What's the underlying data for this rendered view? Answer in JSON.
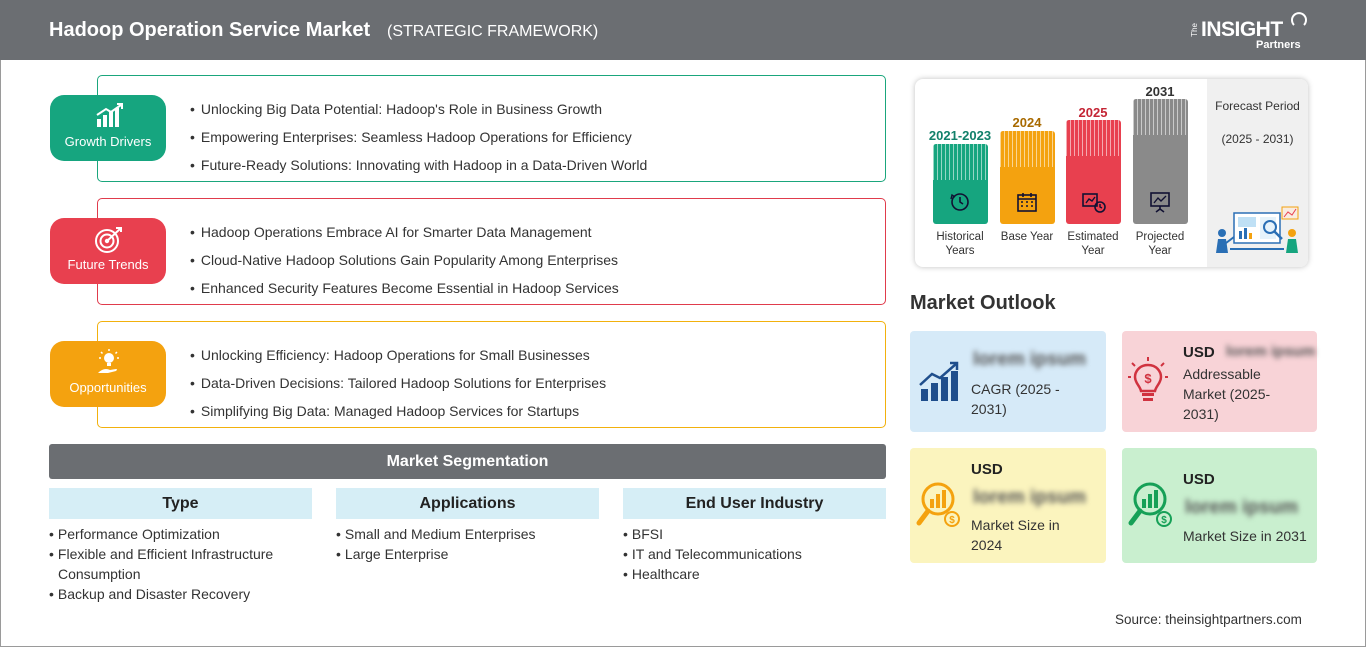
{
  "header": {
    "title": "Hadoop Operation Service Market",
    "subtitle": "(STRATEGIC FRAMEWORK)",
    "logo": {
      "the": "The",
      "insight": "INSIGHT",
      "partners": "Partners"
    }
  },
  "framework": {
    "growth_drivers": {
      "label": "Growth Drivers",
      "color": "#16a57f",
      "items": [
        "Unlocking Big Data Potential: Hadoop's Role in Business Growth",
        "Empowering Enterprises: Seamless Hadoop Operations for Efficiency",
        "Future-Ready Solutions: Innovating with Hadoop in a Data-Driven World"
      ]
    },
    "future_trends": {
      "label": "Future Trends",
      "color": "#e8404f",
      "items": [
        "Hadoop Operations Embrace AI for Smarter Data Management",
        "Cloud-Native Hadoop Solutions Gain Popularity Among Enterprises",
        "Enhanced Security Features Become Essential in Hadoop Services"
      ]
    },
    "opportunities": {
      "label": "Opportunities",
      "color": "#f4a20f",
      "items": [
        "Unlocking Efficiency: Hadoop Operations for Small Businesses",
        "Data-Driven Decisions: Tailored Hadoop Solutions for Enterprises",
        "Simplifying Big Data: Managed Hadoop Services for Startups"
      ]
    }
  },
  "segmentation": {
    "title": "Market Segmentation",
    "columns": [
      {
        "header": "Type",
        "items": [
          "Performance Optimization",
          "Flexible and Efficient Infrastructure Consumption",
          "Backup and Disaster Recovery"
        ]
      },
      {
        "header": "Applications",
        "items": [
          "Small and Medium Enterprises",
          "Large Enterprise"
        ]
      },
      {
        "header": "End User Industry",
        "items": [
          "BFSI",
          "IT and Telecommunications",
          "Healthcare"
        ]
      }
    ]
  },
  "timeline": {
    "periods": [
      {
        "year": "2021-2023",
        "caption": "Historical Years",
        "color": "#16a57f",
        "year_color": "#11806a"
      },
      {
        "year": "2024",
        "caption": "Base Year",
        "color": "#f4a20f",
        "year_color": "#a86a00"
      },
      {
        "year": "2025",
        "caption": "Estimated Year",
        "color": "#e8404f",
        "year_color": "#c42535"
      },
      {
        "year": "2031",
        "caption": "Projected Year",
        "color": "#8a8a8a",
        "year_color": "#333333"
      }
    ],
    "forecast": {
      "label": "Forecast Period",
      "range": "(2025 - 2031)"
    }
  },
  "outlook": {
    "title": "Market Outlook",
    "cards": [
      {
        "usd": "",
        "value": "lorem ipsum",
        "desc": "CAGR (2025 - 2031)",
        "bg": "#d6eaf8",
        "icon": "growth-chart-icon"
      },
      {
        "usd": "USD",
        "value": "lorem ipsum",
        "desc": "Addressable Market (2025-2031)",
        "bg": "#f8d3d7",
        "icon": "lightbulb-dollar-icon"
      },
      {
        "usd": "USD",
        "value": "lorem ipsum",
        "desc": "Market Size in 2024",
        "bg": "#fbf4be",
        "icon": "magnifier-chart-icon"
      },
      {
        "usd": "USD",
        "value": "lorem ipsum",
        "desc": "Market Size in 2031",
        "bg": "#c9efcf",
        "icon": "magnifier-chart-icon"
      }
    ]
  },
  "source": "Source: theinsightpartners.com"
}
